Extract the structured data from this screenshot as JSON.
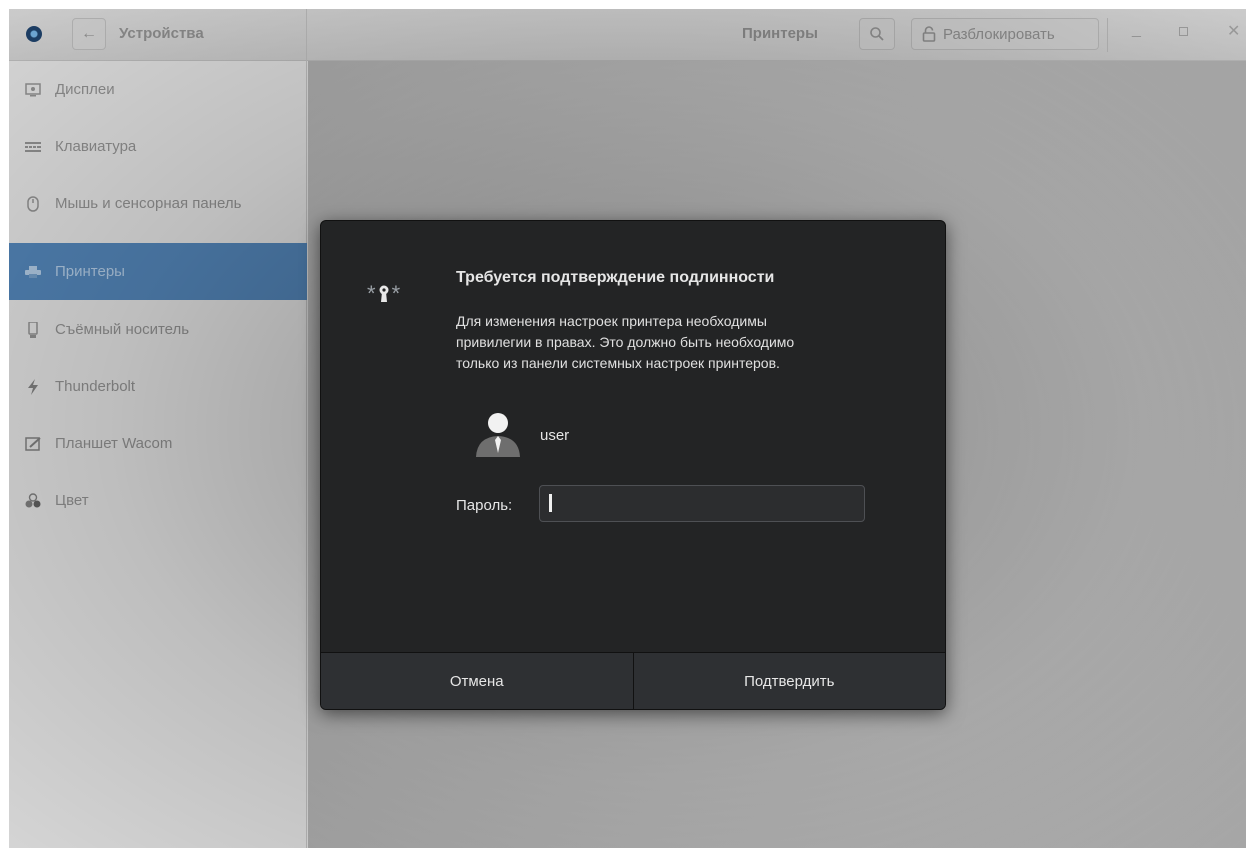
{
  "header": {
    "left_title": "Устройства",
    "center_title": "Принтеры",
    "unlock_label": "Разблокировать"
  },
  "sidebar": {
    "items": [
      {
        "label": "Дисплеи",
        "icon": "display-icon"
      },
      {
        "label": "Клавиатура",
        "icon": "keyboard-icon"
      },
      {
        "label": "Мышь и сенсорная панель",
        "icon": "mouse-icon"
      },
      {
        "label": "Принтеры",
        "icon": "printer-icon",
        "selected": true
      },
      {
        "label": "Съёмный носитель",
        "icon": "removable-media-icon"
      },
      {
        "label": "Thunderbolt",
        "icon": "thunderbolt-icon"
      },
      {
        "label": "Планшет Wacom",
        "icon": "tablet-icon"
      },
      {
        "label": "Цвет",
        "icon": "color-icon"
      }
    ]
  },
  "dialog": {
    "title": "Требуется подтверждение подлинности",
    "body_lines": [
      "Для изменения настроек принтера необходимы",
      "привилегии в правах. Это должно быть необходимо",
      "только из панели системных настроек принтеров."
    ],
    "username": "user",
    "password_label": "Пароль:",
    "password_value": "",
    "cancel_label": "Отмена",
    "confirm_label": "Подтвердить"
  },
  "colors": {
    "selection": "#4f7fb0",
    "dialog_bg": "#232425"
  }
}
